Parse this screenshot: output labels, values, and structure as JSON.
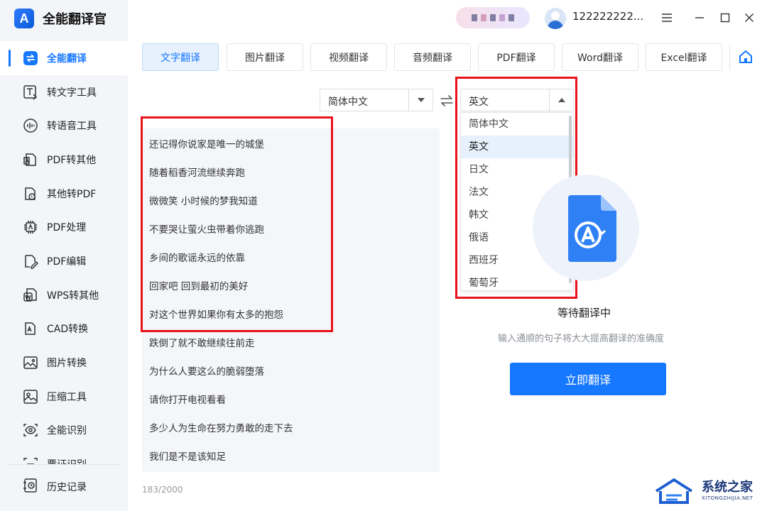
{
  "app": {
    "title": "全能翻译官",
    "logo_letter": "A"
  },
  "user": {
    "name": "122222222..."
  },
  "sidebar": {
    "items": [
      {
        "label": "全能翻译",
        "icon": "translate-swap-icon",
        "active": true
      },
      {
        "label": "转文字工具",
        "icon": "text-convert-icon"
      },
      {
        "label": "转语音工具",
        "icon": "voice-icon"
      },
      {
        "label": "PDF转其他",
        "icon": "pdf-export-icon"
      },
      {
        "label": "其他转PDF",
        "icon": "pdf-import-icon"
      },
      {
        "label": "PDF处理",
        "icon": "pdf-process-icon"
      },
      {
        "label": "PDF编辑",
        "icon": "pdf-edit-icon"
      },
      {
        "label": "WPS转其他",
        "icon": "wps-icon"
      },
      {
        "label": "CAD转换",
        "icon": "cad-icon"
      },
      {
        "label": "图片转换",
        "icon": "image-convert-icon"
      },
      {
        "label": "压缩工具",
        "icon": "compress-icon"
      },
      {
        "label": "全能识别",
        "icon": "recognize-eye-icon"
      },
      {
        "label": "票证识别",
        "icon": "ticket-scan-icon"
      }
    ],
    "history_label": "历史记录"
  },
  "tabs": [
    {
      "label": "文字翻译",
      "active": true
    },
    {
      "label": "图片翻译"
    },
    {
      "label": "视频翻译"
    },
    {
      "label": "音频翻译"
    },
    {
      "label": "PDF翻译"
    },
    {
      "label": "Word翻译"
    },
    {
      "label": "Excel翻译"
    }
  ],
  "source_lang": "简体中文",
  "target_lang": "英文",
  "dropdown": {
    "options": [
      "简体中文",
      "英文",
      "日文",
      "法文",
      "韩文",
      "俄语",
      "西班牙",
      "葡萄牙"
    ],
    "selected": "英文"
  },
  "input_lines": [
    "还记得你说家是唯一的城堡",
    "随着稻香河流继续奔跑",
    "微微笑 小时候的梦我知道",
    "不要哭让萤火虫带着你逃跑",
    "乡间的歌谣永远的依靠",
    "回家吧 回到最初的美好",
    "对这个世界如果你有太多的抱怨",
    "跌倒了就不敢继续往前走",
    "为什么人要这么的脆弱堕落",
    "请你打开电视看看",
    "多少人为生命在努力勇敢的走下去",
    "我们是不是该知足"
  ],
  "char_count": "183/2000",
  "status": {
    "title": "等待翻译中",
    "hint": "输入通顺的句子将大大提高翻译的准确度"
  },
  "translate_button": "立即翻译",
  "watermark": {
    "title": "系统之家",
    "subtitle": "XITONGZHIJIA.NET"
  },
  "colors": {
    "accent": "#1677ff",
    "highlight": "#e8121b",
    "sidebar_bg": "#f3f5f8"
  }
}
